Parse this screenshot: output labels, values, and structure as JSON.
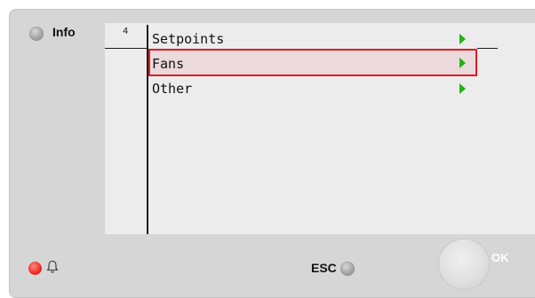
{
  "controls": {
    "info_label": "Info",
    "esc_label": "ESC",
    "ok_label": "OK"
  },
  "screen": {
    "page_number": "4",
    "menu_items": [
      {
        "label": "Setpoints",
        "selected": false
      },
      {
        "label": "Fans",
        "selected": true
      },
      {
        "label": "Other",
        "selected": false
      }
    ]
  },
  "icons": {
    "info_led": "grey-led-icon",
    "alarm_led": "red-led-icon",
    "alarm_bell": "bell-icon",
    "esc_led": "grey-led-icon",
    "menu_arrow": "green-arrow-right-icon"
  },
  "colors": {
    "panel": "#d6d6d6",
    "screen": "#ececec",
    "selection_border": "#e01b24",
    "selection_fill": "#ecd9db",
    "arrow": "#23b114",
    "alarm_led": "#ee2b22"
  }
}
